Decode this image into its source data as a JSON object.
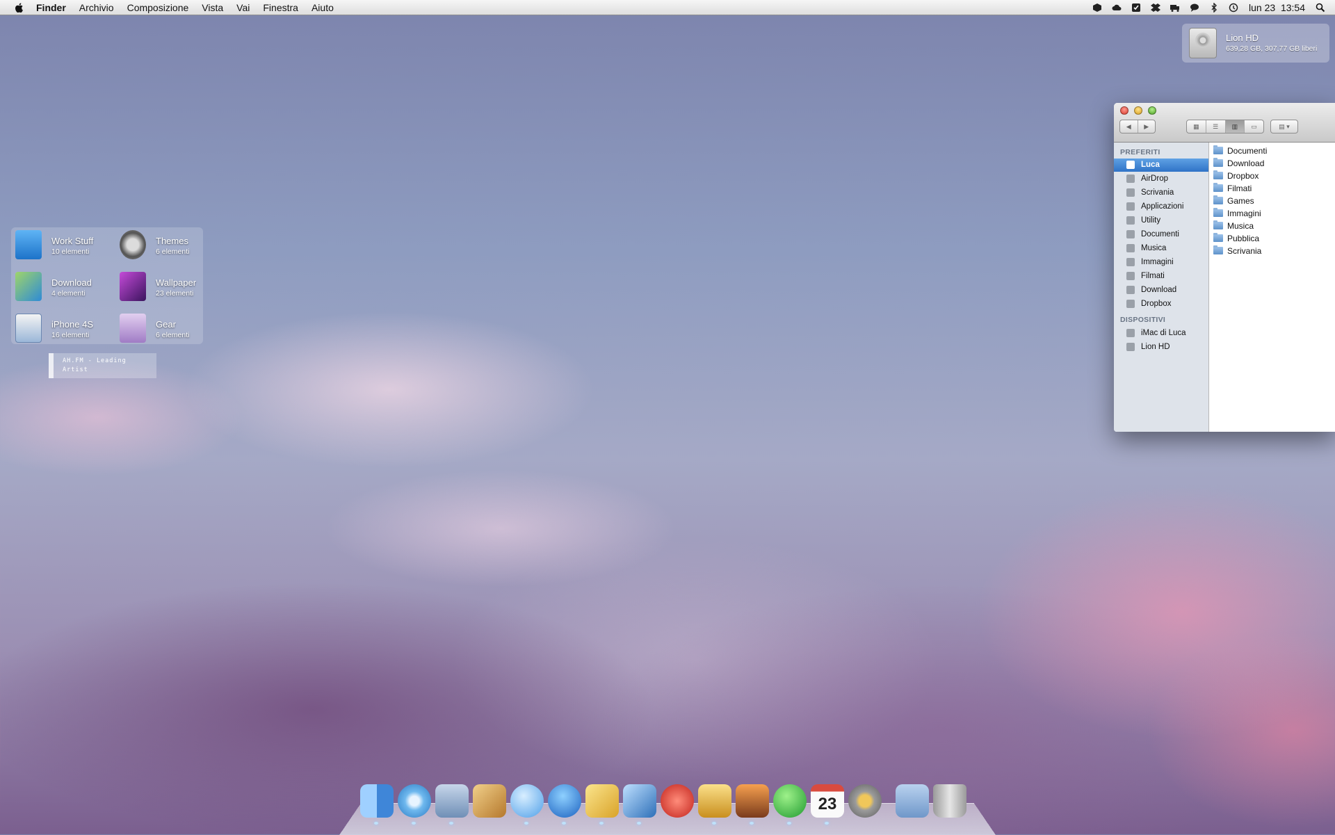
{
  "menubar": {
    "app": "Finder",
    "items": [
      "Archivio",
      "Composizione",
      "Vista",
      "Vai",
      "Finestra",
      "Aiuto"
    ],
    "status_icons": [
      "box-icon",
      "cloud-icon",
      "checkbox-icon",
      "dropbox-icon",
      "truck-icon",
      "chat-icon",
      "bluetooth-icon",
      "time-machine-icon"
    ],
    "clock": "lun 23  13:54",
    "colors": {
      "bar": "#e8e8e8",
      "text": "#111111"
    }
  },
  "disk_widget": {
    "name": "Lion HD",
    "space": "639,28 GB, 307,77 GB liberi"
  },
  "shortcuts": [
    {
      "name": "Work Stuff",
      "count": "10 elementi",
      "color": "#2f8fe0"
    },
    {
      "name": "Themes",
      "count": "6 elementi",
      "color": "#6d6d6d"
    },
    {
      "name": "Download",
      "count": "4 elementi",
      "color": "#2e9ad6"
    },
    {
      "name": "Wallpaper",
      "count": "23 elementi",
      "color": "#7a2fa0"
    },
    {
      "name": "iPhone 4S",
      "count": "16 elementi",
      "color": "#3d7bc7"
    },
    {
      "name": "Gear",
      "count": "6 elementi",
      "color": "#b58fd3"
    }
  ],
  "music_widget": {
    "text": "AH.FM - Leading Artist"
  },
  "finder": {
    "sidebar_sections": [
      {
        "title": "PREFERITI",
        "items": [
          {
            "label": "Luca",
            "icon": "home-icon",
            "selected": true
          },
          {
            "label": "AirDrop",
            "icon": "airdrop-icon"
          },
          {
            "label": "Scrivania",
            "icon": "desktop-icon"
          },
          {
            "label": "Applicazioni",
            "icon": "applications-icon"
          },
          {
            "label": "Utility",
            "icon": "utility-icon"
          },
          {
            "label": "Documenti",
            "icon": "document-icon"
          },
          {
            "label": "Musica",
            "icon": "music-icon"
          },
          {
            "label": "Immagini",
            "icon": "camera-icon"
          },
          {
            "label": "Filmati",
            "icon": "film-icon"
          },
          {
            "label": "Download",
            "icon": "download-icon"
          },
          {
            "label": "Dropbox",
            "icon": "dropbox-icon"
          }
        ]
      },
      {
        "title": "DISPOSITIVI",
        "items": [
          {
            "label": "iMac di Luca",
            "icon": "imac-icon"
          },
          {
            "label": "Lion HD",
            "icon": "harddisk-icon"
          }
        ]
      }
    ],
    "files": [
      "Documenti",
      "Download",
      "Dropbox",
      "Filmati",
      "Games",
      "Immagini",
      "Musica",
      "Pubblica",
      "Scrivania"
    ],
    "selection_color": "#3a7fd0"
  },
  "dock": {
    "apps": [
      {
        "name": "finder-icon",
        "color": "#5aa3e8",
        "running": true
      },
      {
        "name": "safari-icon",
        "color": "#4fa3d9",
        "running": true
      },
      {
        "name": "mail-icon",
        "color": "#8aa2c4",
        "running": true
      },
      {
        "name": "sparrow-package-icon",
        "color": "#d5a24a",
        "running": false
      },
      {
        "name": "messages-icon",
        "color": "#65b0f0",
        "running": true
      },
      {
        "name": "itunes-icon",
        "color": "#2c7fd6",
        "running": true
      },
      {
        "name": "notes-pencil-icon",
        "color": "#e9c24b",
        "running": true
      },
      {
        "name": "xcode-icon",
        "color": "#3d86c9",
        "running": true
      },
      {
        "name": "scrobbler-icon",
        "color": "#d93d3d",
        "running": false
      },
      {
        "name": "transmit-truck-icon",
        "color": "#e3b340",
        "running": true
      },
      {
        "name": "iphoto-icon",
        "color": "#c86c35",
        "running": true
      },
      {
        "name": "skype-icon",
        "color": "#37b24a",
        "running": true
      },
      {
        "name": "calendar-icon",
        "color": "#f0f0f0",
        "running": true
      },
      {
        "name": "keychain-icon",
        "color": "#a9a9a9",
        "running": false
      }
    ],
    "stacks": [
      {
        "name": "applications-folder-icon",
        "color": "#7fa6d6"
      },
      {
        "name": "trash-icon",
        "color": "#c8c8c8"
      }
    ],
    "calendar_day": "23"
  }
}
